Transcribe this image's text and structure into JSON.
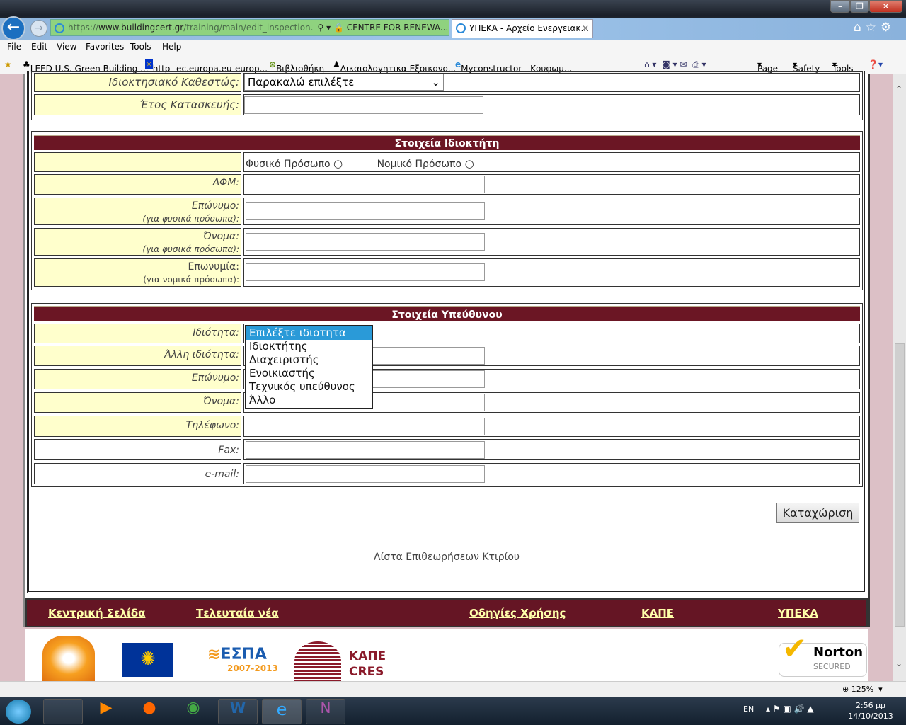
{
  "browser": {
    "url_prefix": "https://",
    "url_domain": "www.buildingcert.gr",
    "url_path": "/training/main/edit_inspection.",
    "cert": "CENTRE FOR RENEWA...",
    "tab_title": "ΥΠΕΚΑ - Αρχείο Ενεργειακ...",
    "menu": [
      "File",
      "Edit",
      "View",
      "Favorites",
      "Tools",
      "Help"
    ],
    "favorites": [
      "LEED  U.S. Green Building ...",
      "http--ec.europa.eu-europ...",
      "Βιβλιοθήκη",
      "Δικαιολογητικα Εξοικονο...",
      "Myconstructor - Κουφωμ..."
    ],
    "commands": [
      "Page",
      "Safety",
      "Tools"
    ],
    "zoom": "125%"
  },
  "form": {
    "ownership_label": "Ιδιοκτησιακό Καθεστώς:",
    "ownership_value": "Παρακαλώ επιλέξτε",
    "year_label": "Έτος Κατασκευής:",
    "owner": {
      "title": "Στοιχεία Ιδιοκτήτη",
      "radio_natural": "Φυσικό Πρόσωπο",
      "radio_legal": "Νομικό Πρόσωπο",
      "afm": "ΑΦΜ:",
      "surname": "Επώνυμο:",
      "surname_note": "(για φυσικά πρόσωπα):",
      "name": "Όνομα:",
      "name_note": "(για φυσικά πρόσωπα):",
      "company": "Επωνυμία:",
      "company_note": "(για νομικά πρόσωπα):"
    },
    "responsible": {
      "title": "Στοιχεία Υπεύθυνου",
      "capacity": "Ιδιότητα:",
      "other_capacity": "Άλλη ιδιότητα:",
      "surname": "Επώνυμο:",
      "name": "Όνομα:",
      "phone": "Τηλέφωνο:",
      "fax": "Fax:",
      "email": "e-mail:",
      "capacity_options": [
        "Επιλέξτε ιδιοτητα",
        "Ιδιοκτήτης",
        "Διαχειριστής",
        "Ενοικιαστής",
        "Τεχνικός υπεύθυνος",
        "Άλλο"
      ],
      "capacity_selected": "Επιλέξτε ιδιοτητα"
    },
    "save": "Καταχώριση",
    "list_link": "Λίστα Επιθεωρήσεων Κτιρίου"
  },
  "footer": {
    "links": [
      "Κεντρική Σελίδα",
      "Τελευταία νέα",
      "Οδηγίες Χρήσης",
      "ΚΑΠΕ",
      "ΥΠΕΚΑ"
    ],
    "logos": {
      "espa": "ΕΣΠΑ",
      "espa_years": "2007-2013",
      "kape": "ΚΑΠΕ",
      "cres": "CRES",
      "norton": "Norton",
      "norton_sub": "SECURED",
      "eu": "Ευρωπαϊκή Ένωση"
    }
  },
  "taskbar": {
    "lang": "EN",
    "time": "2:56 μμ",
    "date": "14/10/2013"
  },
  "colors": {
    "maroon": "#6b1624",
    "label_bg": "#ffffcc",
    "link_yellow": "#ffffaa"
  }
}
